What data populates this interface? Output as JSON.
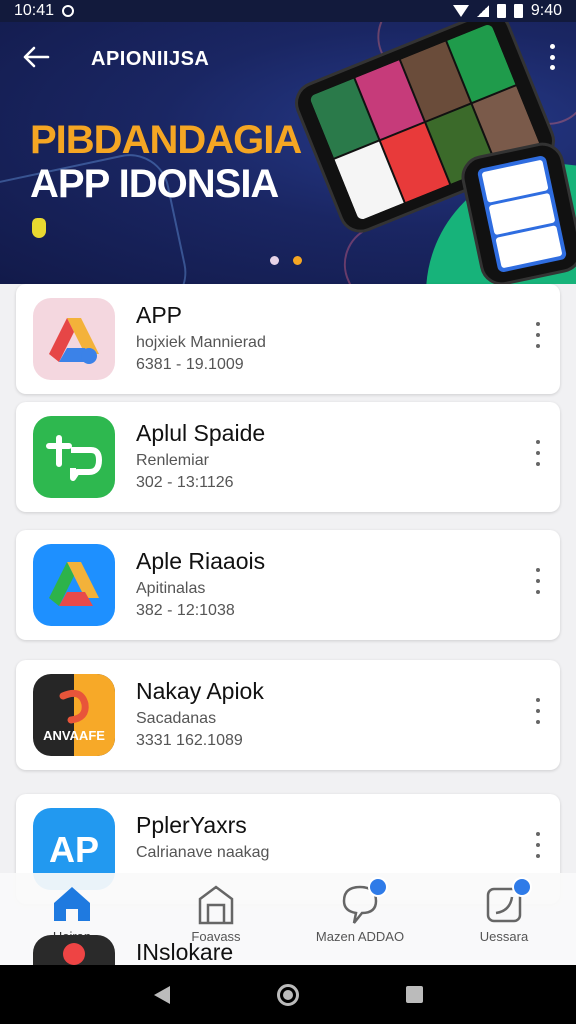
{
  "status_bar": {
    "time_left": "10:41",
    "time_right": "9:40"
  },
  "header": {
    "title": "APIONIIJSA"
  },
  "banner": {
    "line1": "PIBDANDAGIA",
    "line2": "APP IDONSIA",
    "colors": {
      "line1": "#f5a623",
      "line2": "#ffffff",
      "background": "#1a2663"
    },
    "slide_index": 2,
    "slide_count": 2
  },
  "apps": [
    {
      "name": "APP",
      "subtitle": "hojxiek Mannierad",
      "meta": "6381 - 19.1009",
      "icon": "drive-triangle-icon"
    },
    {
      "name": "Aplul Spaide",
      "subtitle": "Renlemiar",
      "meta": "302 - 13:1126",
      "icon": "green-chat-icon"
    },
    {
      "name": "Aple Riaaois",
      "subtitle": "Apitinalas",
      "meta": "382 - 12:1038",
      "icon": "drive-triangle-icon"
    },
    {
      "name": "Nakay Apiok",
      "subtitle": "Sacadanas",
      "meta": "3331 162.1089",
      "icon": "anvaafe-icon"
    },
    {
      "name": "PplerYaxrs",
      "subtitle": "Calrianave naakag",
      "meta": "",
      "icon": "ap-icon"
    },
    {
      "name": "INslokare",
      "subtitle": "",
      "meta": "",
      "icon": "dark-red-icon"
    }
  ],
  "bottom_nav": [
    {
      "label": "Heiran",
      "icon": "home-icon",
      "active": true
    },
    {
      "label": "Foavass",
      "icon": "building-icon",
      "active": false
    },
    {
      "label": "Mazen ADDAO",
      "icon": "chat-bubble-icon",
      "active": false
    },
    {
      "label": "Uessara",
      "icon": "edit-icon",
      "active": false
    }
  ]
}
